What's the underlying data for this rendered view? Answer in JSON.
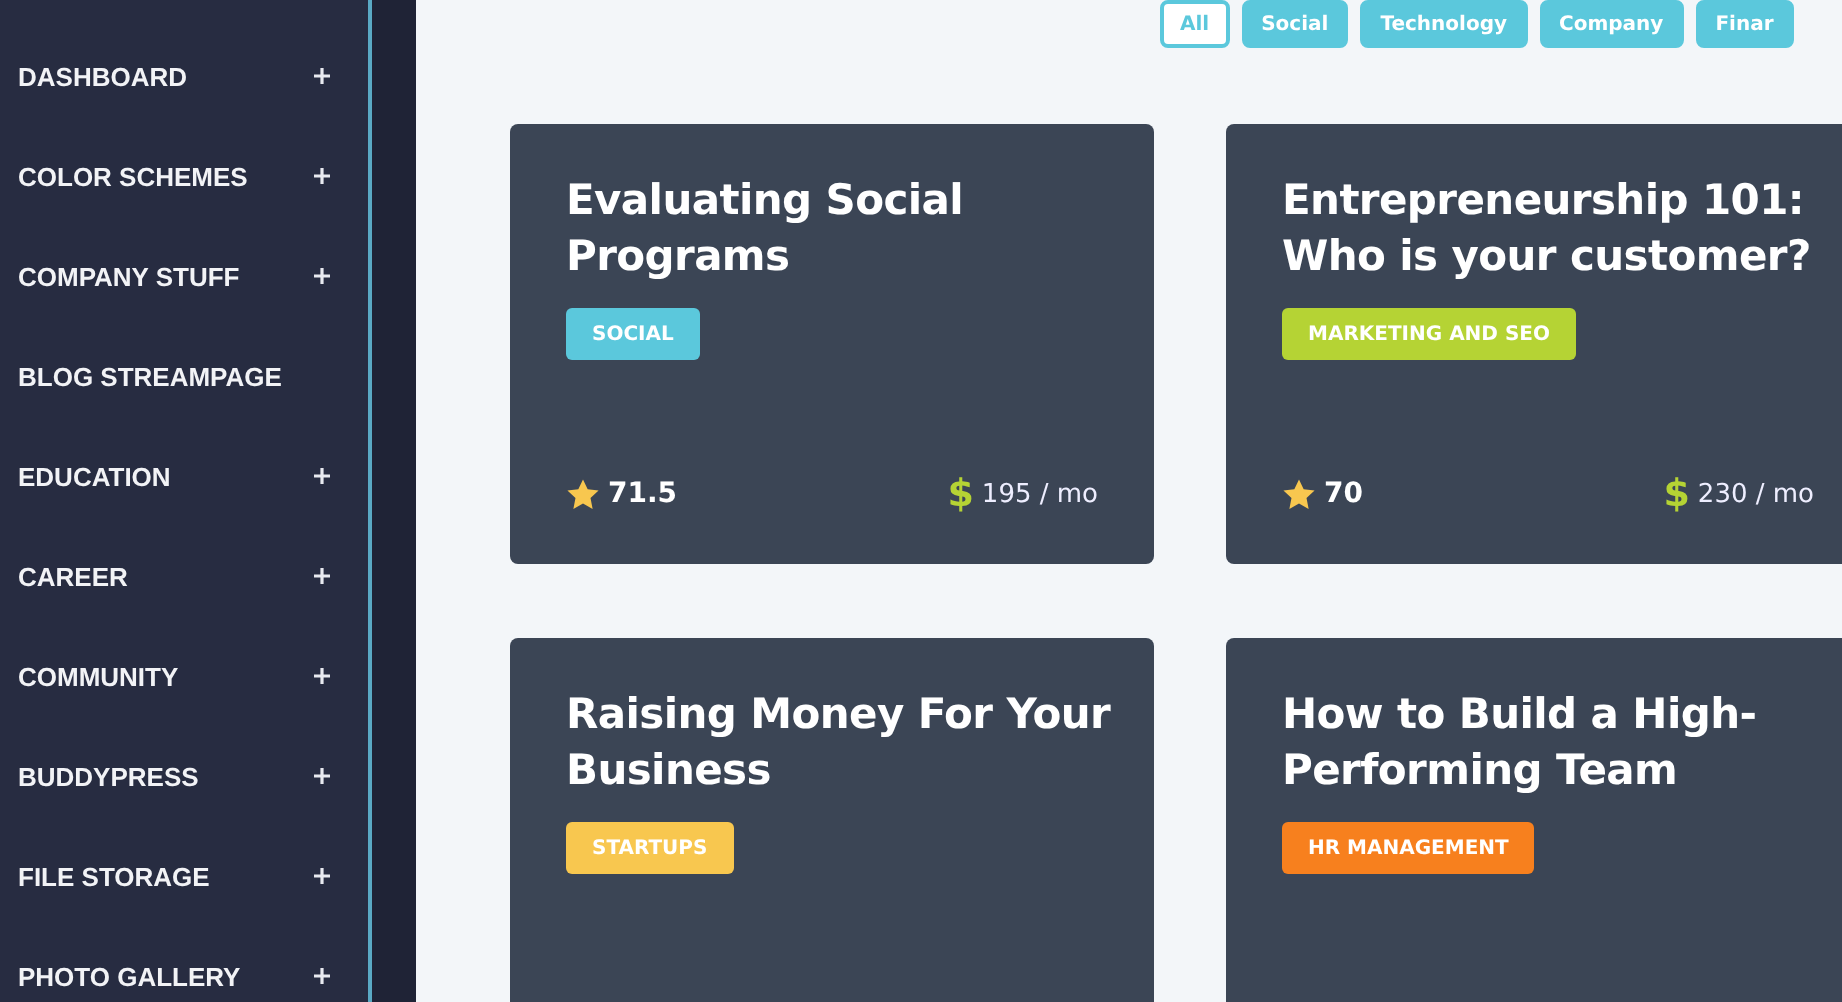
{
  "sidebar": {
    "items": [
      {
        "label": "DASHBOARD",
        "expandable": true
      },
      {
        "label": "COLOR SCHEMES",
        "expandable": true
      },
      {
        "label": "COMPANY STUFF",
        "expandable": true
      },
      {
        "label": "BLOG STREAMPAGE",
        "expandable": false
      },
      {
        "label": "EDUCATION",
        "expandable": true
      },
      {
        "label": "CAREER",
        "expandable": true
      },
      {
        "label": "COMMUNITY",
        "expandable": true
      },
      {
        "label": "BUDDYPRESS",
        "expandable": true
      },
      {
        "label": "FILE STORAGE",
        "expandable": true
      },
      {
        "label": "PHOTO GALLERY",
        "expandable": true
      }
    ]
  },
  "filters": [
    {
      "label": "All",
      "selected": true
    },
    {
      "label": "Social",
      "selected": false
    },
    {
      "label": "Technology",
      "selected": false
    },
    {
      "label": "Company",
      "selected": false
    },
    {
      "label": "Finar",
      "selected": false
    }
  ],
  "cards": [
    {
      "title": "Evaluating Social Programs",
      "tag": {
        "label": "SOCIAL",
        "color": "#5bc8dc"
      },
      "rating": "71.5",
      "currency": "$",
      "price": "195 / mo"
    },
    {
      "title": "Entrepreneurship 101: Who is your customer?",
      "tag": {
        "label": "MARKETING AND SEO",
        "color": "#b5d334"
      },
      "rating": "70",
      "currency": "$",
      "price": "230 / mo"
    },
    {
      "title": "Raising Money For Your Business",
      "tag": {
        "label": "STARTUPS",
        "color": "#f8c74f"
      }
    },
    {
      "title": "How to Build a High-Performing Team",
      "tag": {
        "label": "HR MANAGEMENT",
        "color": "#f7801e"
      }
    }
  ]
}
